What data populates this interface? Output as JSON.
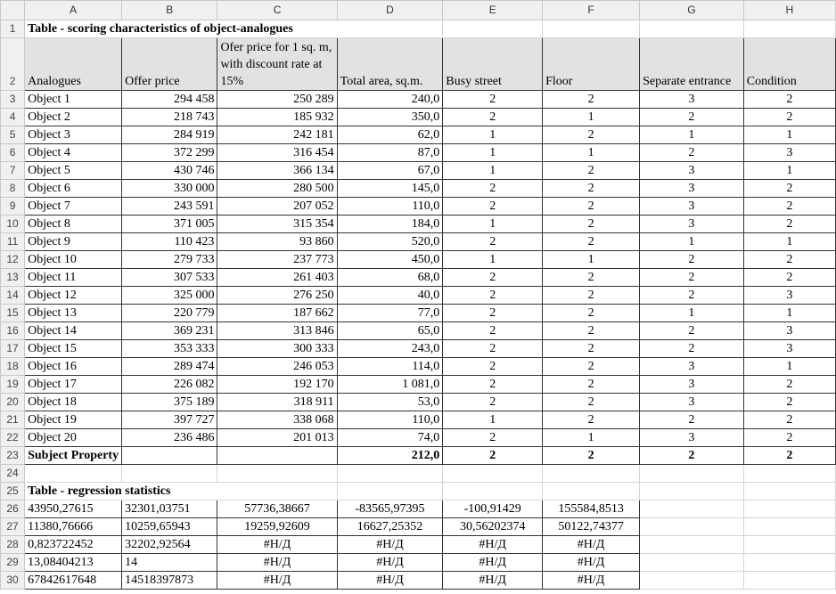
{
  "columns": [
    "A",
    "B",
    "C",
    "D",
    "E",
    "F",
    "G",
    "H"
  ],
  "table1": {
    "title": "Table - scoring characteristics of object-analogues",
    "headers": [
      "Analogues",
      "Offer price",
      "Ofer price for 1 sq. m, with discount rate at 15%",
      "Total area, sq.m.",
      "Busy street",
      "Floor",
      "Separate entrance",
      "Condition"
    ],
    "rows": [
      [
        "Object 1",
        "294 458",
        "250 289",
        "240,0",
        "2",
        "2",
        "3",
        "2"
      ],
      [
        "Object 2",
        "218 743",
        "185 932",
        "350,0",
        "2",
        "1",
        "2",
        "2"
      ],
      [
        "Object 3",
        "284 919",
        "242 181",
        "62,0",
        "1",
        "2",
        "1",
        "1"
      ],
      [
        "Object 4",
        "372 299",
        "316 454",
        "87,0",
        "1",
        "1",
        "2",
        "3"
      ],
      [
        "Object 5",
        "430 746",
        "366 134",
        "67,0",
        "1",
        "2",
        "3",
        "1"
      ],
      [
        "Object 6",
        "330 000",
        "280 500",
        "145,0",
        "2",
        "2",
        "3",
        "2"
      ],
      [
        "Object 7",
        "243 591",
        "207 052",
        "110,0",
        "2",
        "2",
        "3",
        "2"
      ],
      [
        "Object 8",
        "371 005",
        "315 354",
        "184,0",
        "1",
        "2",
        "3",
        "2"
      ],
      [
        "Object 9",
        "110 423",
        "93 860",
        "520,0",
        "2",
        "2",
        "1",
        "1"
      ],
      [
        "Object 10",
        "279 733",
        "237 773",
        "450,0",
        "1",
        "1",
        "2",
        "2"
      ],
      [
        "Object 11",
        "307 533",
        "261 403",
        "68,0",
        "2",
        "2",
        "2",
        "2"
      ],
      [
        "Object 12",
        "325 000",
        "276 250",
        "40,0",
        "2",
        "2",
        "2",
        "3"
      ],
      [
        "Object 13",
        "220 779",
        "187 662",
        "77,0",
        "2",
        "2",
        "1",
        "1"
      ],
      [
        "Object 14",
        "369 231",
        "313 846",
        "65,0",
        "2",
        "2",
        "2",
        "3"
      ],
      [
        "Object 15",
        "353 333",
        "300 333",
        "243,0",
        "2",
        "2",
        "2",
        "3"
      ],
      [
        "Object 16",
        "289 474",
        "246 053",
        "114,0",
        "2",
        "2",
        "3",
        "1"
      ],
      [
        "Object 17",
        "226 082",
        "192 170",
        "1 081,0",
        "2",
        "2",
        "3",
        "2"
      ],
      [
        "Object 18",
        "375 189",
        "318 911",
        "53,0",
        "2",
        "2",
        "3",
        "2"
      ],
      [
        "Object 19",
        "397 727",
        "338 068",
        "110,0",
        "1",
        "2",
        "2",
        "2"
      ],
      [
        "Object 20",
        "236 486",
        "201 013",
        "74,0",
        "2",
        "1",
        "3",
        "2"
      ]
    ],
    "subject": [
      "Subject Property",
      "",
      "",
      "212,0",
      "2",
      "2",
      "2",
      "2"
    ]
  },
  "table2": {
    "title": "Table - regression statistics",
    "rows": [
      [
        "43950,27615",
        "32301,03751",
        "57736,38667",
        "-83565,97395",
        "-100,91429",
        "155584,8513"
      ],
      [
        "11380,76666",
        "10259,65943",
        "19259,92609",
        "16627,25352",
        "30,56202374",
        "50122,74377"
      ],
      [
        "0,823722452",
        "32202,92564",
        "#Н/Д",
        "#Н/Д",
        "#Н/Д",
        "#Н/Д"
      ],
      [
        "13,08404213",
        "14",
        "#Н/Д",
        "#Н/Д",
        "#Н/Д",
        "#Н/Д"
      ],
      [
        "67842617648",
        "14518397873",
        "#Н/Д",
        "#Н/Д",
        "#Н/Д",
        "#Н/Д"
      ]
    ]
  }
}
